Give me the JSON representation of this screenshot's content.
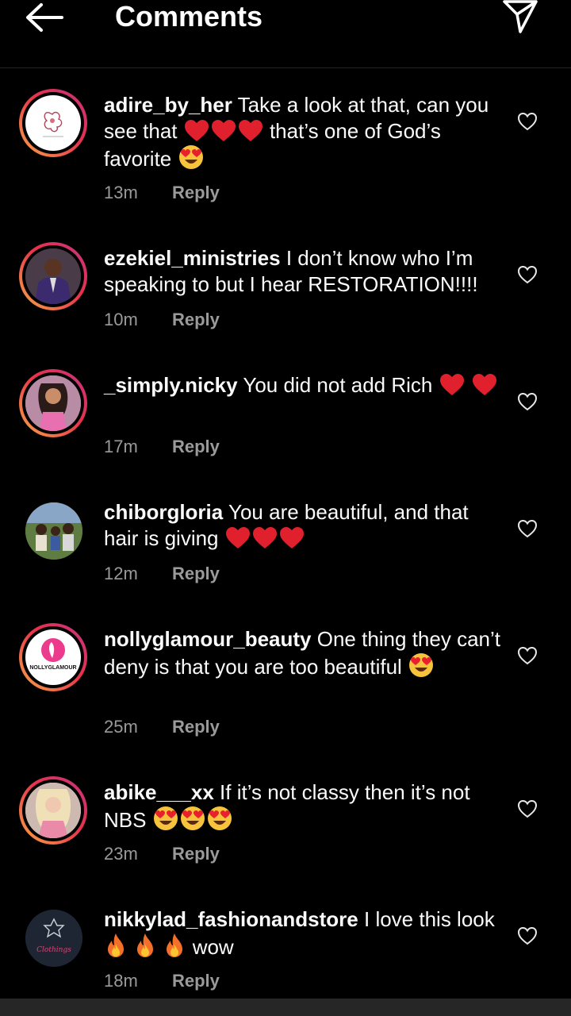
{
  "header": {
    "title": "Comments",
    "back_icon": "arrow-left-icon",
    "send_icon": "paper-plane-icon"
  },
  "reply_label": "Reply",
  "comments": [
    {
      "user": "adire_by_her",
      "text_parts": [
        "Take a look at that, can you see that ",
        "❤",
        "❤",
        "❤",
        " that’s one of God’s favorite ",
        "😍"
      ],
      "time": "13m",
      "avatar_ring": true
    },
    {
      "user": "ezekiel_ministries",
      "text_parts": [
        "I don’t know who I’m speaking to but I hear RESTORATION!!!!"
      ],
      "time": "10m",
      "avatar_ring": true
    },
    {
      "user": "_simply.nicky",
      "text_parts": [
        "You did not add Rich ",
        "❤",
        " ",
        "❤"
      ],
      "time": "17m",
      "avatar_ring": true
    },
    {
      "user": "chiborgloria",
      "text_parts": [
        "You are beautiful, and that hair is giving ",
        "❤",
        "❤",
        "❤"
      ],
      "time": "12m",
      "avatar_ring": false
    },
    {
      "user": "nollyglamour_beauty",
      "text_parts": [
        "One thing they can’t deny is that you are too beautiful ",
        "😍"
      ],
      "time": "25m",
      "avatar_ring": true,
      "avatar_text": "NOLLYGLAMOUR"
    },
    {
      "user": "abike___xx",
      "text_parts": [
        "If it’s not classy then it’s not NBS ",
        "😍",
        "😍",
        "😍"
      ],
      "time": "23m",
      "avatar_ring": true
    },
    {
      "user": "nikkylad_fashionandstore",
      "text_parts": [
        "I love this look",
        "🔥",
        " ",
        "🔥",
        " ",
        "🔥",
        " wow"
      ],
      "time": "18m",
      "avatar_ring": false,
      "avatar_text": "Clothings"
    }
  ]
}
